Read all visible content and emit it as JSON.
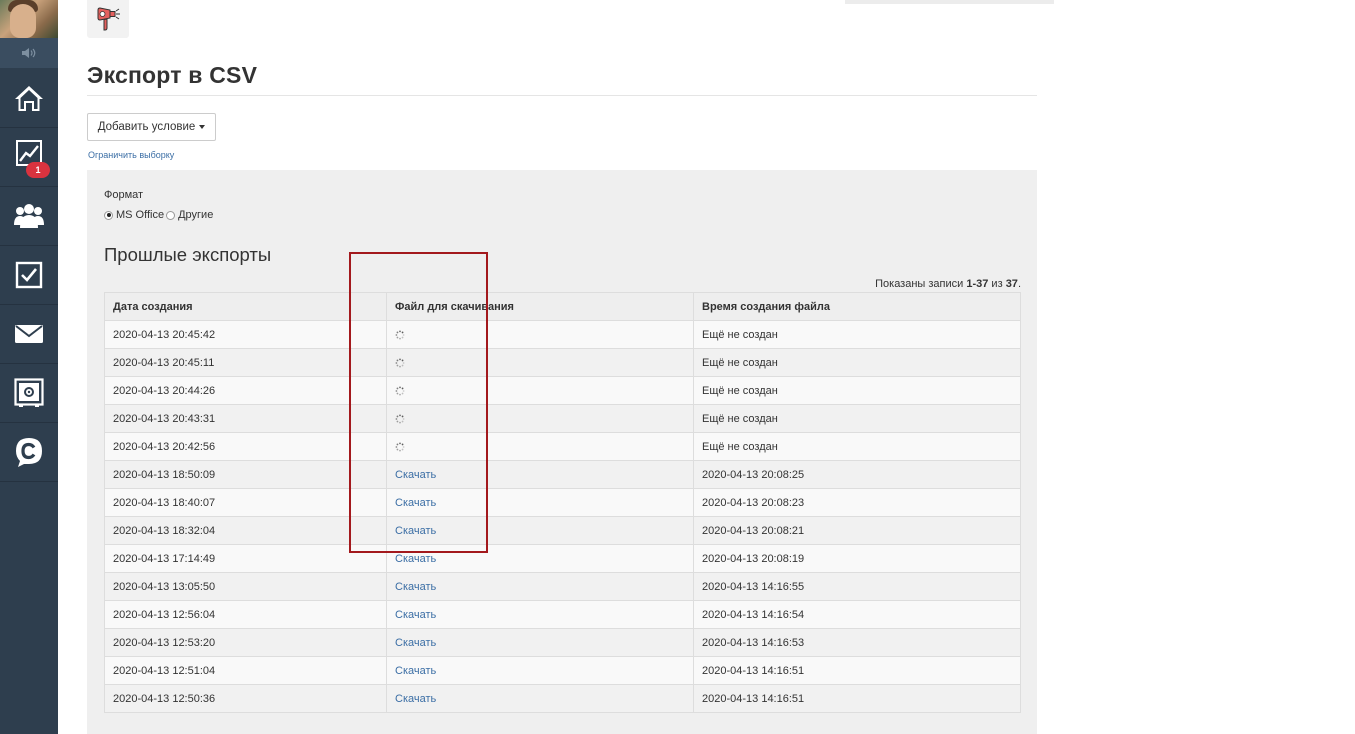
{
  "sidebar": {
    "badge_count": "1",
    "items": [
      {
        "name": "home-icon"
      },
      {
        "name": "chart-icon"
      },
      {
        "name": "users-icon"
      },
      {
        "name": "tasks-icon"
      },
      {
        "name": "mail-icon"
      },
      {
        "name": "safe-icon"
      },
      {
        "name": "chat-icon"
      }
    ]
  },
  "page": {
    "title": "Экспорт в CSV",
    "add_condition_label": "Добавить условие",
    "limit_selection_link": "Ограничить выборку"
  },
  "format": {
    "label": "Формат",
    "options": [
      {
        "label": "MS Office",
        "checked": true
      },
      {
        "label": "Другие",
        "checked": false
      }
    ]
  },
  "past_exports": {
    "title": "Прошлые экспорты",
    "records_prefix": "Показаны записи ",
    "records_range": "1-37",
    "records_middle": " из ",
    "records_total": "37",
    "records_suffix": ".",
    "columns": [
      "Дата создания",
      "Файл для скачивания",
      "Время создания файла"
    ],
    "download_label": "Скачать",
    "rows": [
      {
        "created": "2020-04-13 20:45:42",
        "ready": false,
        "file_time": "Ещё не создан"
      },
      {
        "created": "2020-04-13 20:45:11",
        "ready": false,
        "file_time": "Ещё не создан"
      },
      {
        "created": "2020-04-13 20:44:26",
        "ready": false,
        "file_time": "Ещё не создан"
      },
      {
        "created": "2020-04-13 20:43:31",
        "ready": false,
        "file_time": "Ещё не создан"
      },
      {
        "created": "2020-04-13 20:42:56",
        "ready": false,
        "file_time": "Ещё не создан"
      },
      {
        "created": "2020-04-13 18:50:09",
        "ready": true,
        "file_time": "2020-04-13 20:08:25"
      },
      {
        "created": "2020-04-13 18:40:07",
        "ready": true,
        "file_time": "2020-04-13 20:08:23"
      },
      {
        "created": "2020-04-13 18:32:04",
        "ready": true,
        "file_time": "2020-04-13 20:08:21"
      },
      {
        "created": "2020-04-13 17:14:49",
        "ready": true,
        "file_time": "2020-04-13 20:08:19"
      },
      {
        "created": "2020-04-13 13:05:50",
        "ready": true,
        "file_time": "2020-04-13 14:16:55"
      },
      {
        "created": "2020-04-13 12:56:04",
        "ready": true,
        "file_time": "2020-04-13 14:16:54"
      },
      {
        "created": "2020-04-13 12:53:20",
        "ready": true,
        "file_time": "2020-04-13 14:16:53"
      },
      {
        "created": "2020-04-13 12:51:04",
        "ready": true,
        "file_time": "2020-04-13 14:16:51"
      },
      {
        "created": "2020-04-13 12:50:36",
        "ready": true,
        "file_time": "2020-04-13 14:16:51"
      }
    ]
  },
  "colors": {
    "sidebar_bg": "#2e3e4e",
    "link": "#3b6ea5",
    "badge": "#d9333f",
    "highlight": "#a3191d"
  }
}
